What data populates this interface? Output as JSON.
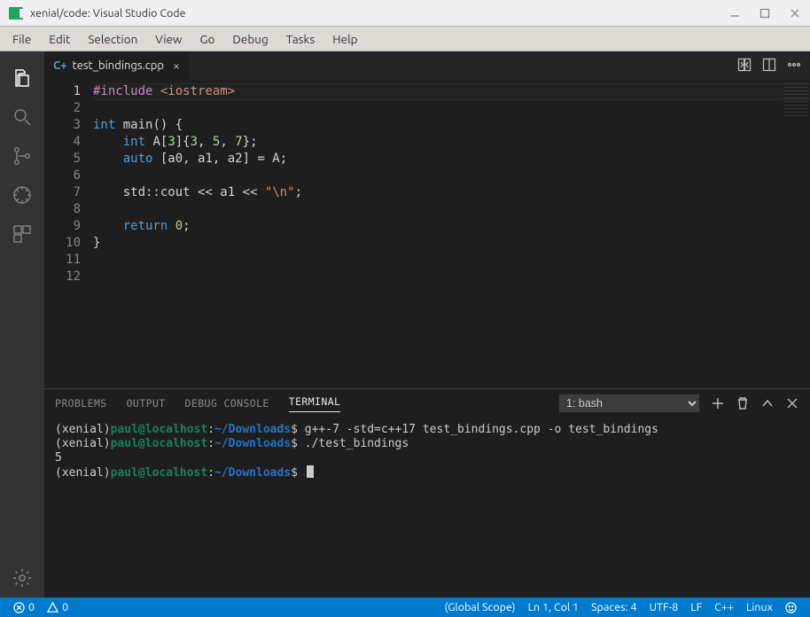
{
  "window": {
    "title": "xenial/code: Visual Studio Code"
  },
  "menu": [
    "File",
    "Edit",
    "Selection",
    "View",
    "Go",
    "Debug",
    "Tasks",
    "Help"
  ],
  "tab": {
    "filename": "test_bindings.cpp",
    "file_icon": "C+"
  },
  "code": {
    "lines": [
      {
        "n": 1,
        "tokens": [
          [
            "tk-pre",
            "#include"
          ],
          [
            "tk-pl",
            " "
          ],
          [
            "tk-inc",
            "<iostream>"
          ]
        ]
      },
      {
        "n": 2,
        "tokens": []
      },
      {
        "n": 3,
        "tokens": [
          [
            "tk-key",
            "int"
          ],
          [
            "tk-pl",
            " "
          ],
          [
            "tk-id",
            "main() {"
          ]
        ]
      },
      {
        "n": 4,
        "tokens": [
          [
            "tk-pl",
            "    "
          ],
          [
            "tk-key",
            "int"
          ],
          [
            "tk-pl",
            " "
          ],
          [
            "tk-id",
            "A["
          ],
          [
            "tk-num",
            "3"
          ],
          [
            "tk-id",
            "]{"
          ],
          [
            "tk-num",
            "3"
          ],
          [
            "tk-id",
            ", "
          ],
          [
            "tk-num",
            "5"
          ],
          [
            "tk-id",
            ", "
          ],
          [
            "tk-num",
            "7"
          ],
          [
            "tk-id",
            "};"
          ]
        ]
      },
      {
        "n": 5,
        "tokens": [
          [
            "tk-pl",
            "    "
          ],
          [
            "tk-key",
            "auto"
          ],
          [
            "tk-pl",
            " "
          ],
          [
            "tk-id",
            "[a0, a1, a2] = A;"
          ]
        ]
      },
      {
        "n": 6,
        "tokens": []
      },
      {
        "n": 7,
        "tokens": [
          [
            "tk-pl",
            "    "
          ],
          [
            "tk-id",
            "std::cout << a1 << "
          ],
          [
            "tk-str",
            "\"\\n\""
          ],
          [
            "tk-id",
            ";"
          ]
        ]
      },
      {
        "n": 8,
        "tokens": []
      },
      {
        "n": 9,
        "tokens": [
          [
            "tk-pl",
            "    "
          ],
          [
            "tk-key",
            "return"
          ],
          [
            "tk-pl",
            " "
          ],
          [
            "tk-num",
            "0"
          ],
          [
            "tk-id",
            ";"
          ]
        ]
      },
      {
        "n": 10,
        "tokens": [
          [
            "tk-id",
            "}"
          ]
        ]
      },
      {
        "n": 11,
        "tokens": []
      },
      {
        "n": 12,
        "tokens": []
      }
    ]
  },
  "panel": {
    "tabs": [
      "PROBLEMS",
      "OUTPUT",
      "DEBUG CONSOLE",
      "TERMINAL"
    ],
    "active_tab": "TERMINAL",
    "shell_select": "1: bash",
    "terminal_lines": [
      {
        "ctx": "(xenial)",
        "user": "paul@localhost",
        "sep": ":",
        "path": "~/Downloads",
        "dollar": "$ ",
        "cmd": "g++-7 -std=c++17 test_bindings.cpp -o test_bindings"
      },
      {
        "ctx": "(xenial)",
        "user": "paul@localhost",
        "sep": ":",
        "path": "~/Downloads",
        "dollar": "$ ",
        "cmd": "./test_bindings"
      },
      {
        "out": "5"
      },
      {
        "ctx": "(xenial)",
        "user": "paul@localhost",
        "sep": ":",
        "path": "~/Downloads",
        "dollar": "$ ",
        "cursor": true
      }
    ]
  },
  "status": {
    "errors": "0",
    "warnings": "0",
    "scope": "(Global Scope)",
    "ln_col": "Ln 1, Col 1",
    "spaces": "Spaces: 4",
    "encoding": "UTF-8",
    "eol": "LF",
    "lang": "C++",
    "os": "Linux"
  }
}
